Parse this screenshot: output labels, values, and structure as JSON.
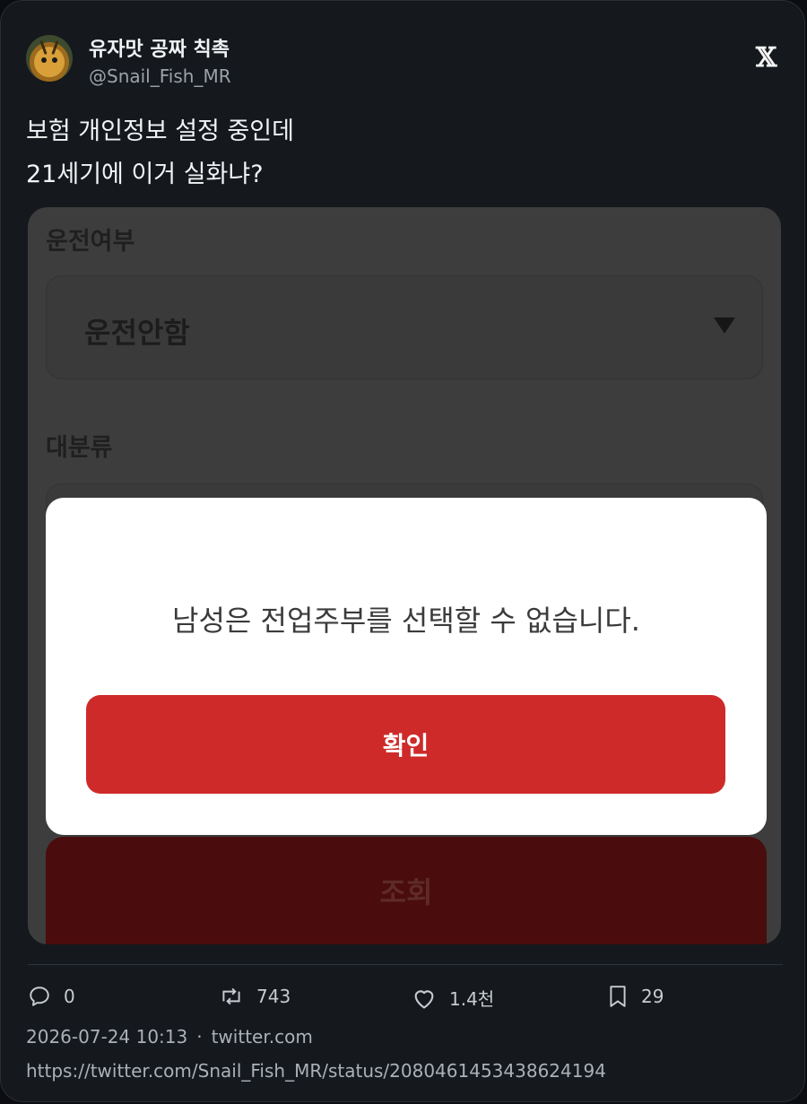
{
  "author": {
    "display_name": "유자맛 공짜 칙촉",
    "handle": "@Snail_Fish_MR",
    "avatar_icon": "snail-avatar"
  },
  "platform_icon": "x-logo-icon",
  "platform_logo_text": "𝕏",
  "tweet": {
    "lines": [
      "보험 개인정보 설정 중인데",
      "21세기에 이거 실화냐?"
    ]
  },
  "screenshot": {
    "driving_label": "운전여부",
    "driving_value": "운전안함",
    "category_label": "대분류",
    "dialog_message": "남성은 전업주부를 선택할 수 없습니다.",
    "confirm_button": "확인",
    "lookup_button": "조회",
    "colors": {
      "confirm": "#cf2a2a",
      "lookup_dimmed": "#4a0c0c"
    }
  },
  "actions": {
    "replies": {
      "icon": "reply-icon",
      "count": "0"
    },
    "retweets": {
      "icon": "retweet-icon",
      "count": "743"
    },
    "likes": {
      "icon": "heart-icon",
      "count": "1.4천"
    },
    "bookmarks": {
      "icon": "bookmark-icon",
      "count": "29"
    }
  },
  "meta": {
    "timestamp": "2026-07-24 10:13",
    "separator": "·",
    "source": "twitter.com",
    "status_url": "https://twitter.com/Snail_Fish_MR/status/2080461453438624194"
  }
}
